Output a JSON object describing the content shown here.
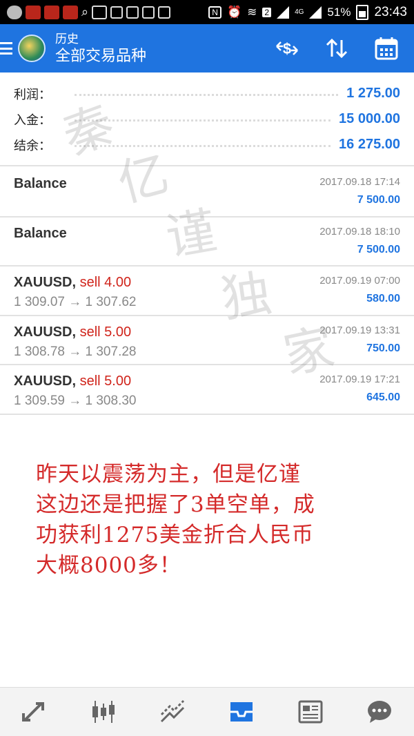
{
  "status_bar": {
    "network": "4G",
    "battery": "51%",
    "time": "23:43"
  },
  "header": {
    "title": "历史",
    "subtitle": "全部交易品种",
    "icons": [
      "menu-icon",
      "currency-exchange-icon",
      "sort-icon",
      "calendar-icon"
    ]
  },
  "summary": {
    "profit_label": "利润：",
    "profit_value": "1 275.00",
    "deposit_label": "入金：",
    "deposit_value": "15 000.00",
    "balance_label": "结余：",
    "balance_value": "16 275.00"
  },
  "trades": [
    {
      "symbol": "Balance",
      "action": "",
      "prices": "",
      "date": "2017.09.18 17:14",
      "amount": "7 500.00"
    },
    {
      "symbol": "Balance",
      "action": "",
      "prices": "",
      "date": "2017.09.18 18:10",
      "amount": "7 500.00"
    },
    {
      "symbol": "XAUUSD,",
      "action": " sell 4.00",
      "prices": "1 309.07 → 1 307.62",
      "date": "2017.09.19 07:00",
      "amount": "580.00"
    },
    {
      "symbol": "XAUUSD,",
      "action": " sell 5.00",
      "prices": "1 308.78 → 1 307.28",
      "date": "2017.09.19 13:31",
      "amount": "750.00"
    },
    {
      "symbol": "XAUUSD,",
      "action": " sell 5.00",
      "prices": "1 309.59 → 1 308.30",
      "date": "2017.09.19 17:21",
      "amount": "645.00"
    }
  ],
  "note": {
    "line1": "昨天以震荡为主，但是亿谨",
    "line2": "这边还是把握了3单空单，成",
    "line3": "功获利1275美金折合人民币",
    "line4": "大概8000多！"
  },
  "watermark": {
    "chars": [
      "秦",
      "亿",
      "谨",
      "独",
      "家"
    ]
  },
  "bottom_nav": {
    "icons": [
      "quotes-icon",
      "chart-candles-icon",
      "trade-icon",
      "history-icon",
      "news-icon",
      "chat-icon"
    ],
    "active": "history-icon",
    "active_color": "#1f74e0",
    "inactive_color": "#666666"
  },
  "colors": {
    "accent": "#1f74e0",
    "sell": "#d0241b",
    "note": "#d42a2a"
  }
}
